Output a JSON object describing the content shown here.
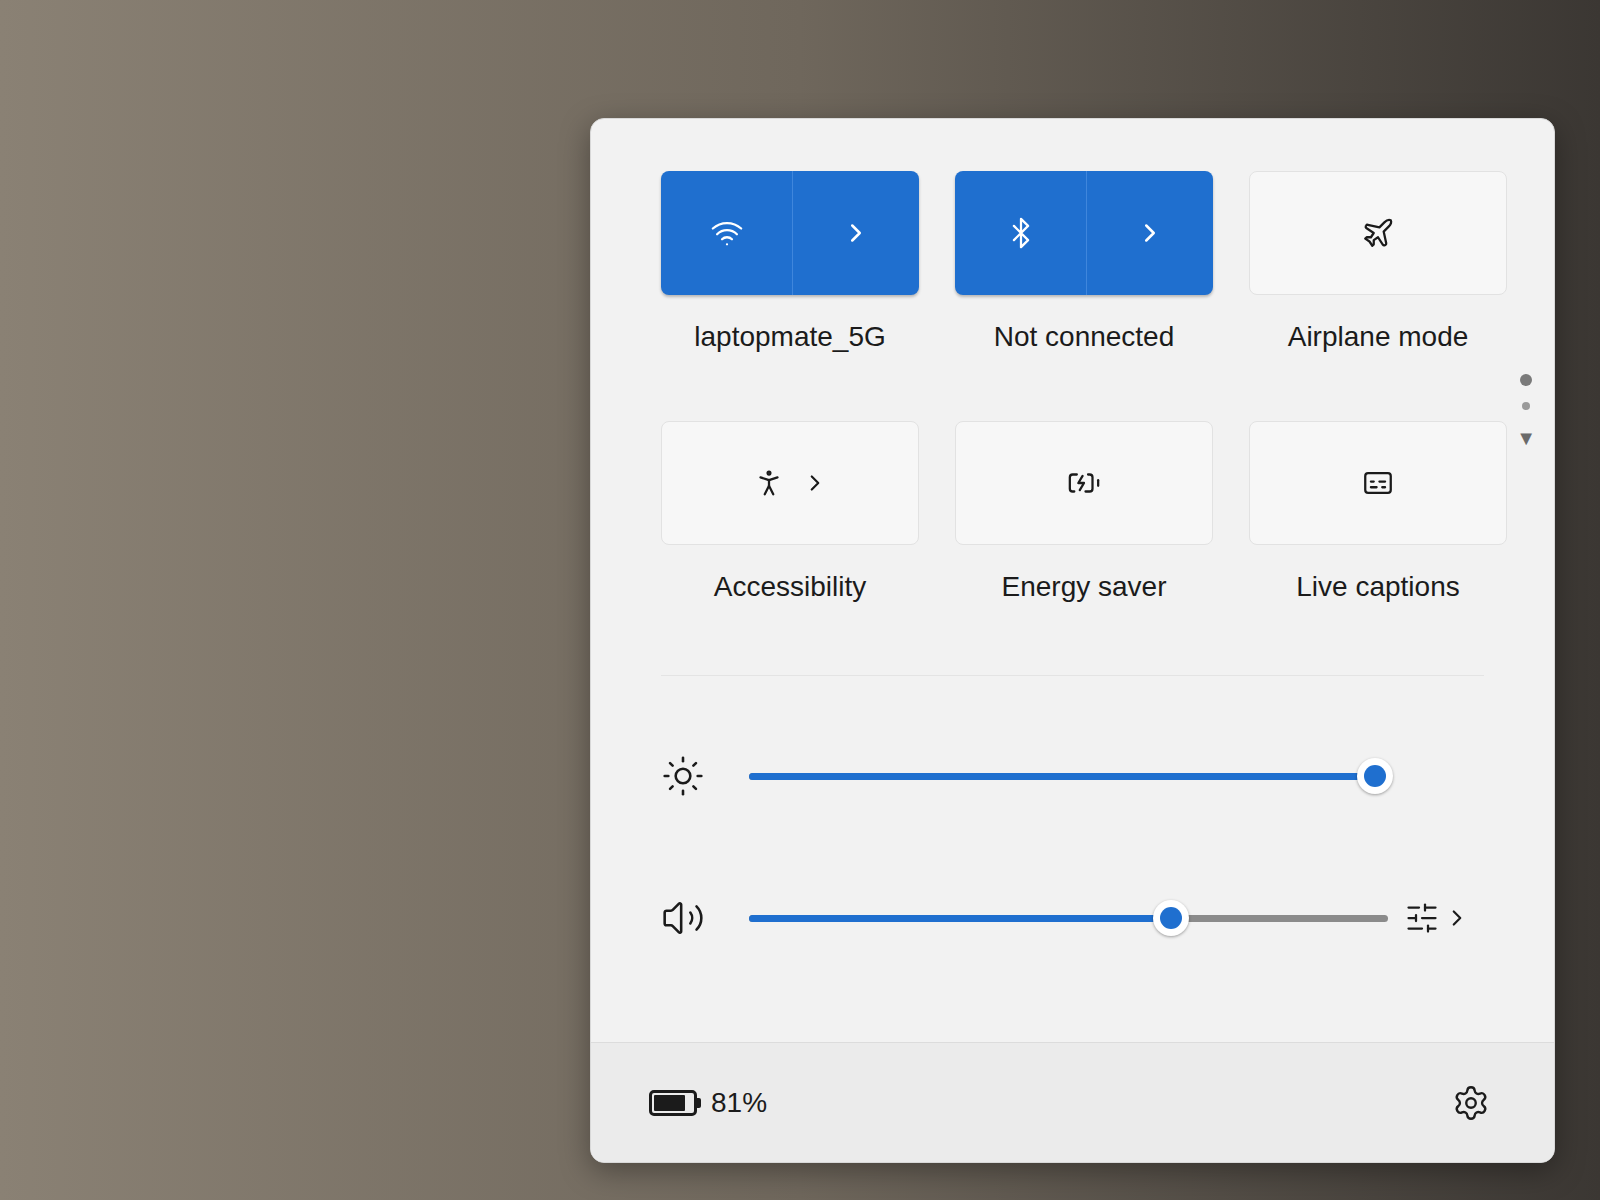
{
  "quick_settings": {
    "tiles": [
      {
        "label": "laptopmate_5G",
        "on": true,
        "has_chevron": true
      },
      {
        "label": "Not connected",
        "on": true,
        "has_chevron": true
      },
      {
        "label": "Airplane mode",
        "on": false,
        "has_chevron": false
      },
      {
        "label": "Accessibility",
        "on": false,
        "has_chevron": true
      },
      {
        "label": "Energy saver",
        "on": false,
        "has_chevron": false
      },
      {
        "label": "Live captions",
        "on": false,
        "has_chevron": false
      }
    ],
    "pages": [
      {
        "selected": true
      },
      {
        "selected": false
      }
    ],
    "next_page": "▼",
    "sliders": [
      {
        "name": "brightness",
        "level": 0.98,
        "has_mixer": false
      },
      {
        "name": "volume",
        "level": 0.66,
        "has_mixer": true
      }
    ],
    "battery": {
      "reading": "81%",
      "level": 0.81
    }
  }
}
